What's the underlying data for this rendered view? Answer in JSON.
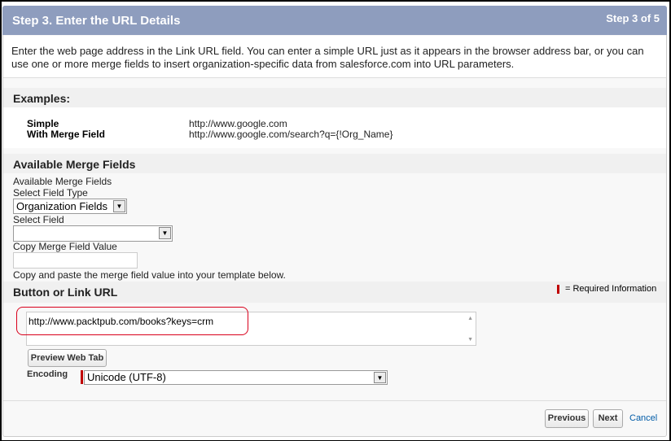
{
  "header": {
    "title": "Step 3. Enter the URL Details",
    "step": "Step 3 of 5"
  },
  "intro": "Enter the web page address in the Link URL field. You can enter a simple URL just as it appears in the browser address bar, or you can use one or more merge fields to insert organization-specific data from salesforce.com into URL parameters.",
  "examples": {
    "title": "Examples:",
    "rows": [
      {
        "label": "Simple",
        "value": "http://www.google.com"
      },
      {
        "label": "With Merge Field",
        "value": "http://www.google.com/search?q={!Org_Name}"
      }
    ]
  },
  "merge": {
    "title": "Available Merge Fields",
    "subtitle": "Available Merge Fields",
    "field_type_label": "Select Field Type",
    "field_type_value": "Organization Fields",
    "field_label": "Select Field",
    "field_value": "",
    "copy_label": "Copy Merge Field Value",
    "copy_value": "",
    "hint": "Copy and paste the merge field value into your template below."
  },
  "url": {
    "title": "Button or Link URL",
    "required": "= Required Information",
    "value": "http://www.packtpub.com/books?keys=crm",
    "preview": "Preview Web Tab",
    "encoding_label": "Encoding",
    "encoding_value": "Unicode (UTF-8)"
  },
  "footer": {
    "previous": "Previous",
    "next": "Next",
    "cancel": "Cancel"
  },
  "colors": {
    "header": "#8e9dbe",
    "required": "#c00000",
    "link": "#015ba7",
    "highlight": "#d9001b"
  }
}
